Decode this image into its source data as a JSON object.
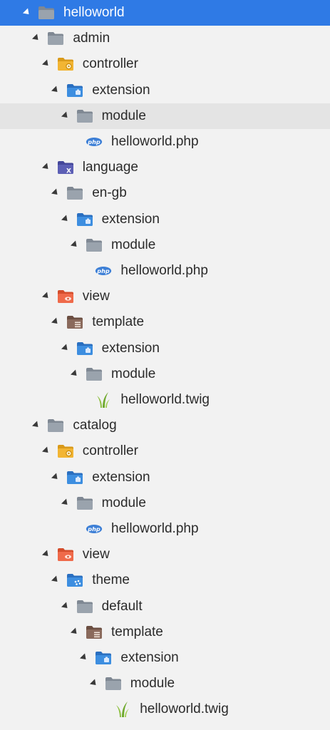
{
  "tree": [
    {
      "label": "helloworld",
      "icon": "folder-gray-icon",
      "level": 0,
      "expandable": true,
      "state": "selected"
    },
    {
      "label": "admin",
      "icon": "folder-gray-icon",
      "level": 1,
      "expandable": true
    },
    {
      "label": "controller",
      "icon": "folder-controller-icon",
      "level": 2,
      "expandable": true
    },
    {
      "label": "extension",
      "icon": "folder-extension-icon",
      "level": 3,
      "expandable": true
    },
    {
      "label": "module",
      "icon": "folder-gray-icon",
      "level": 4,
      "expandable": true,
      "state": "hover"
    },
    {
      "label": "helloworld.php",
      "icon": "php-file-icon",
      "level": 5,
      "expandable": false
    },
    {
      "label": "language",
      "icon": "folder-language-icon",
      "level": 2,
      "expandable": true
    },
    {
      "label": "en-gb",
      "icon": "folder-gray-icon",
      "level": 3,
      "expandable": true
    },
    {
      "label": "extension",
      "icon": "folder-extension-icon",
      "level": 4,
      "expandable": true
    },
    {
      "label": "module",
      "icon": "folder-gray-icon",
      "level": 5,
      "expandable": true
    },
    {
      "label": "helloworld.php",
      "icon": "php-file-icon",
      "level": 6,
      "expandable": false
    },
    {
      "label": "view",
      "icon": "folder-view-icon",
      "level": 2,
      "expandable": true
    },
    {
      "label": "template",
      "icon": "folder-template-icon",
      "level": 3,
      "expandable": true
    },
    {
      "label": "extension",
      "icon": "folder-extension-icon",
      "level": 4,
      "expandable": true
    },
    {
      "label": "module",
      "icon": "folder-gray-icon",
      "level": 5,
      "expandable": true
    },
    {
      "label": "helloworld.twig",
      "icon": "twig-file-icon",
      "level": 6,
      "expandable": false
    },
    {
      "label": "catalog",
      "icon": "folder-gray-icon",
      "level": 1,
      "expandable": true
    },
    {
      "label": "controller",
      "icon": "folder-controller-icon",
      "level": 2,
      "expandable": true
    },
    {
      "label": "extension",
      "icon": "folder-extension-icon",
      "level": 3,
      "expandable": true
    },
    {
      "label": "module",
      "icon": "folder-gray-icon",
      "level": 4,
      "expandable": true
    },
    {
      "label": "helloworld.php",
      "icon": "php-file-icon",
      "level": 5,
      "expandable": false
    },
    {
      "label": "view",
      "icon": "folder-view-icon",
      "level": 2,
      "expandable": true
    },
    {
      "label": "theme",
      "icon": "folder-theme-icon",
      "level": 3,
      "expandable": true
    },
    {
      "label": "default",
      "icon": "folder-gray-icon",
      "level": 4,
      "expandable": true
    },
    {
      "label": "template",
      "icon": "folder-template-icon",
      "level": 5,
      "expandable": true
    },
    {
      "label": "extension",
      "icon": "folder-extension-icon",
      "level": 6,
      "expandable": true
    },
    {
      "label": "module",
      "icon": "folder-gray-icon",
      "level": 7,
      "expandable": true
    },
    {
      "label": "helloworld.twig",
      "icon": "twig-file-icon",
      "level": 8,
      "expandable": false
    }
  ],
  "icons": {
    "php_badge_text": "php"
  },
  "colors": {
    "selection": "#2f7ae5",
    "hover": "#e4e4e4",
    "background": "#f2f2f2",
    "folder_gray": "#9aa3ad",
    "folder_controller": "#f2b533",
    "folder_extension": "#3d8ee0",
    "folder_language": "#5c5fb5",
    "folder_view": "#ef6a4a",
    "folder_template": "#8a6a5c",
    "php_badge": "#3d7fd6",
    "twig_leaf": "#8cbf3f"
  }
}
